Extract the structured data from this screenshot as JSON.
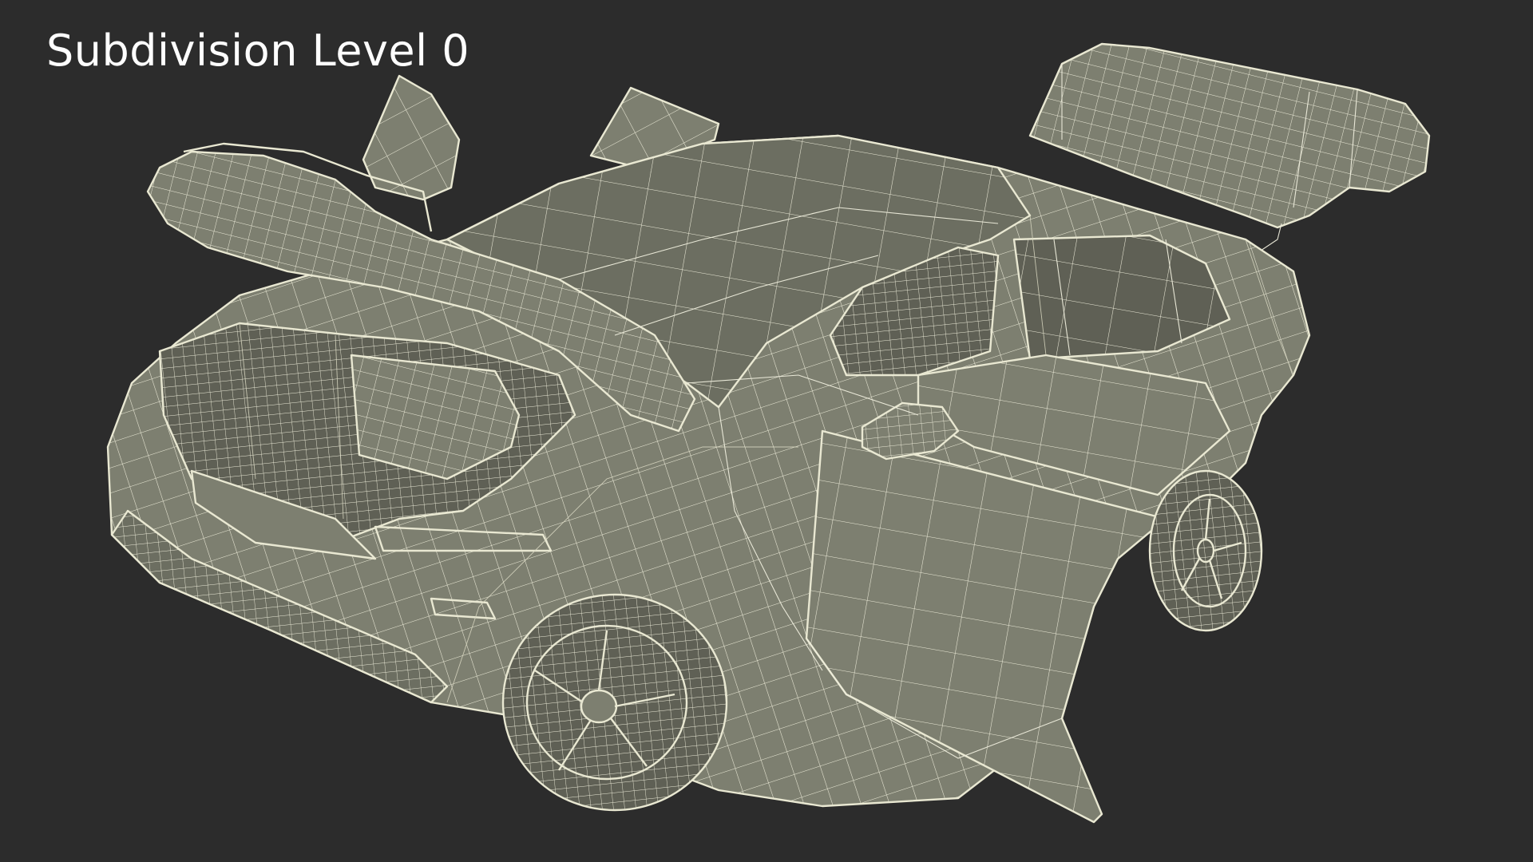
{
  "overlay": {
    "label": "Subdivision Level 0"
  },
  "scene": {
    "background_color": "#2c2c2c",
    "surface_color": "#7d7f70",
    "wire_color": "#eeeddc"
  }
}
